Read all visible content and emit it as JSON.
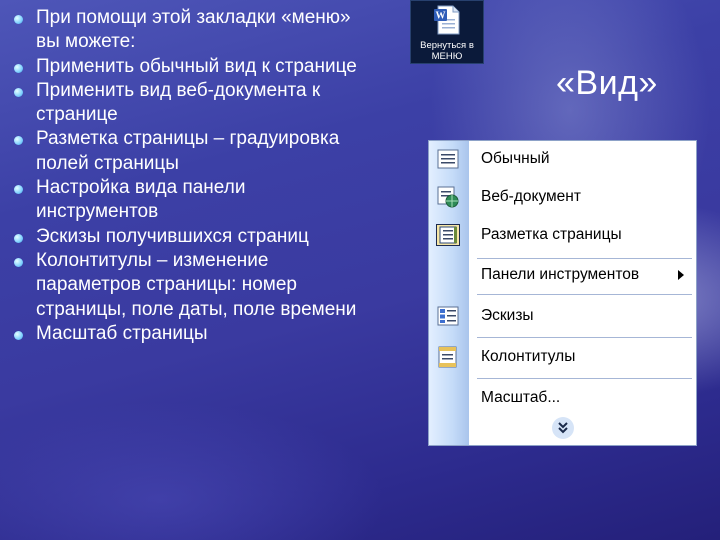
{
  "bullets": [
    "При помощи этой закладки «меню» вы можете:",
    "Применить обычный вид к странице",
    "Применить вид веб-документа к странице",
    "Разметка страницы – градуировка полей страницы",
    "Настройка вида панели инструментов",
    "Эскизы получившихся страниц",
    "Колонтитулы – изменение параметров страницы: номер страницы, поле даты, поле времени",
    "Масштаб страницы"
  ],
  "back_button": {
    "label": "Вернуться в МЕНЮ",
    "icon": "word-document-icon"
  },
  "title": "«Вид»",
  "menu": {
    "items": [
      {
        "label": "Обычный",
        "icon": "normal-view-icon"
      },
      {
        "label": "Веб-документ",
        "icon": "web-document-icon"
      },
      {
        "label": "Разметка страницы",
        "icon": "page-layout-icon",
        "selected": true
      },
      {
        "label": "Панели инструментов",
        "icon": "",
        "submenu": true
      },
      {
        "label": "Эскизы",
        "icon": "thumbnails-icon"
      },
      {
        "label": "Колонтитулы",
        "icon": "header-footer-icon"
      },
      {
        "label": "Масштаб...",
        "icon": ""
      }
    ],
    "expand_icon": "chevron-double-down-icon"
  },
  "colors": {
    "background": "#3a3aa0",
    "menu_gutter": "#c4dbf8",
    "bullet": "#7fd0ff",
    "text": "#ffffff"
  }
}
